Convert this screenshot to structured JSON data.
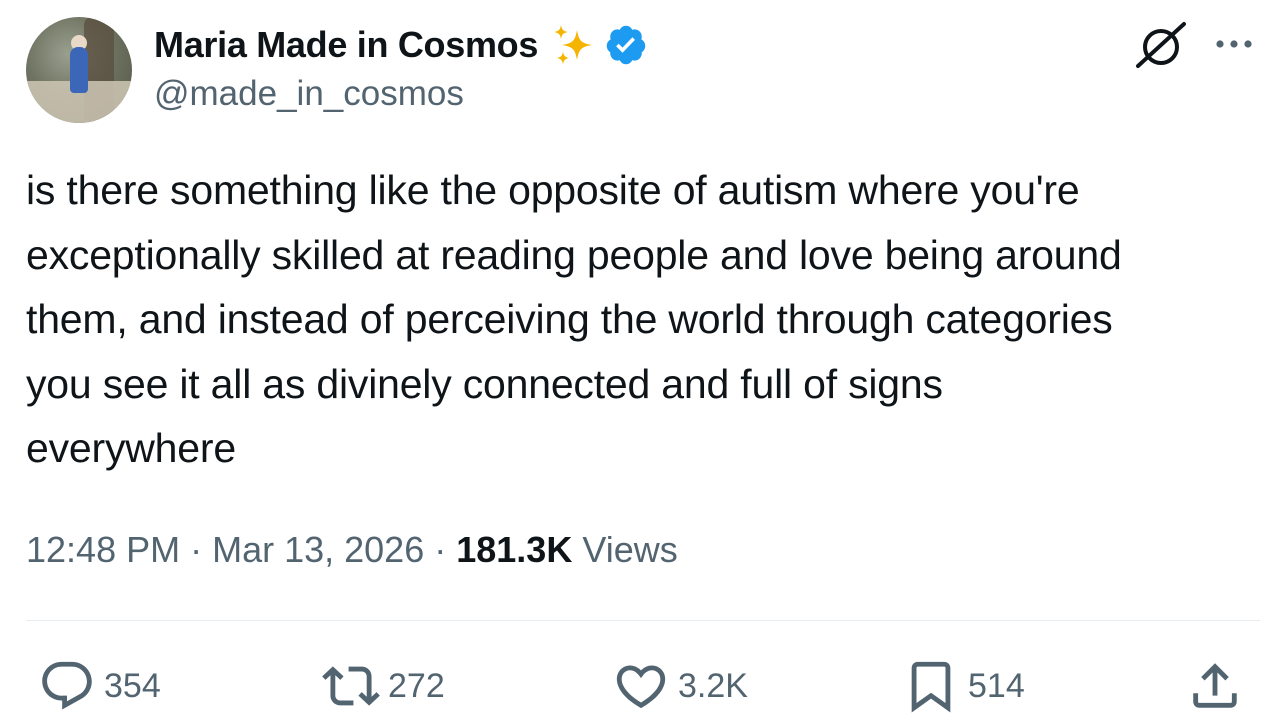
{
  "author": {
    "display_name": "Maria Made in Cosmos",
    "handle": "@made_in_cosmos",
    "verified": true,
    "name_emoji": "sparkles-icon"
  },
  "tweet": {
    "text": "is there something like the opposite of autism where you're\nexceptionally skilled at reading people and love being around\nthem, and instead of perceiving the world through categories\nyou see it all as divinely connected and full of signs\neverywhere"
  },
  "meta": {
    "time": "12:48 PM",
    "separator": "·",
    "date": "Mar 13, 2026",
    "views_count": "181.3K",
    "views_label": "Views"
  },
  "actions": {
    "replies": "354",
    "reposts": "272",
    "likes": "3.2K",
    "bookmarks": "514"
  },
  "icons": {
    "header": [
      "grok-icon",
      "more-options-icon"
    ],
    "actions": [
      "reply-icon",
      "retweet-icon",
      "like-icon",
      "bookmark-icon",
      "share-icon"
    ]
  },
  "colors": {
    "text_primary": "#0f1419",
    "text_secondary": "#536471",
    "verified_blue": "#1d9bf0",
    "sparkle_gold": "#f4b400",
    "divider": "#e6ecf0"
  }
}
